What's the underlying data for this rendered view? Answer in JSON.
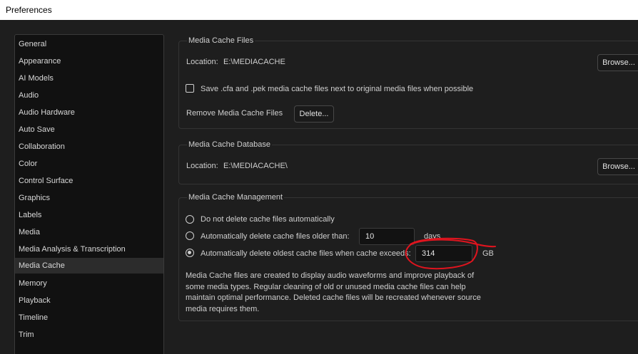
{
  "window": {
    "title": "Preferences"
  },
  "sidebar": {
    "items": [
      {
        "label": "General"
      },
      {
        "label": "Appearance"
      },
      {
        "label": "AI Models"
      },
      {
        "label": "Audio"
      },
      {
        "label": "Audio Hardware"
      },
      {
        "label": "Auto Save"
      },
      {
        "label": "Collaboration"
      },
      {
        "label": "Color"
      },
      {
        "label": "Control Surface"
      },
      {
        "label": "Graphics"
      },
      {
        "label": "Labels"
      },
      {
        "label": "Media"
      },
      {
        "label": "Media Analysis & Transcription"
      },
      {
        "label": "Media Cache"
      },
      {
        "label": "Memory"
      },
      {
        "label": "Playback"
      },
      {
        "label": "Timeline"
      },
      {
        "label": "Trim"
      }
    ],
    "selected": "Media Cache"
  },
  "media_cache_files": {
    "legend": "Media Cache Files",
    "location_label": "Location:",
    "location_value": "E:\\MEDIACACHE",
    "browse_label": "Browse...",
    "save_next_label": "Save .cfa and .pek media cache files next to original media files when possible",
    "save_next_checked": false,
    "remove_label": "Remove Media Cache Files",
    "delete_label": "Delete..."
  },
  "media_cache_database": {
    "legend": "Media Cache Database",
    "location_label": "Location:",
    "location_value": "E:\\MEDIACACHE\\",
    "browse_label": "Browse..."
  },
  "media_cache_management": {
    "legend": "Media Cache Management",
    "option_no_delete": "Do not delete cache files automatically",
    "option_older_than": "Automatically delete cache files older than:",
    "older_than_value": "10",
    "older_than_unit": "days",
    "option_exceeds": "Automatically delete oldest cache files when cache exceeds:",
    "exceeds_value": "314",
    "exceeds_unit": "GB",
    "selected_option": "exceeds",
    "description": "Media Cache files are created to display audio waveforms and improve playback of some media types.  Regular cleaning of old or unused media cache files can help maintain optimal performance. Deleted cache files will be recreated whenever source media requires them."
  },
  "colors": {
    "annotation": "#e0141e",
    "background": "#1e1e1e",
    "sidebar_bg": "#111111"
  }
}
